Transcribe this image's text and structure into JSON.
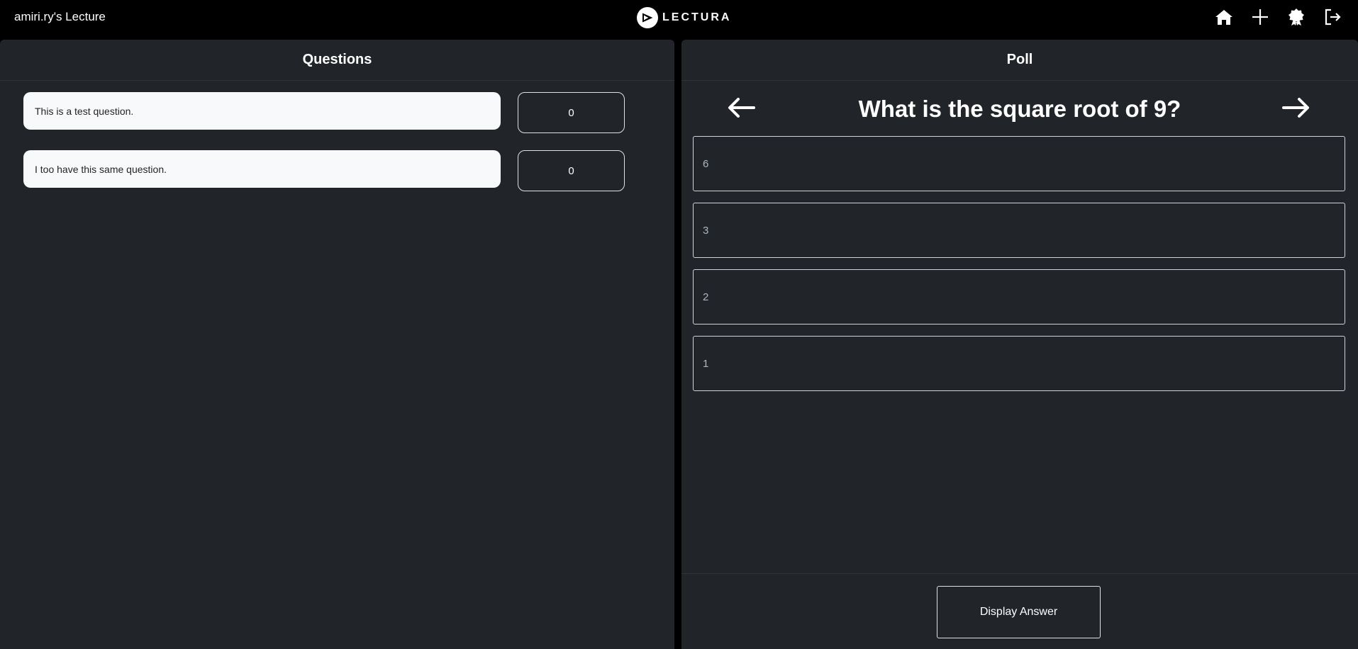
{
  "header": {
    "lecture_title": "amiri.ry's Lecture",
    "logo_text": "LECTURA",
    "nav_icons": [
      "home-icon",
      "plus-icon",
      "award-icon",
      "logout-icon"
    ]
  },
  "questions_panel": {
    "title": "Questions",
    "items": [
      {
        "text": "This is a test question.",
        "votes": "0"
      },
      {
        "text": "I too have this same question.",
        "votes": "0"
      }
    ]
  },
  "poll_panel": {
    "title": "Poll",
    "question": "What is the square root of 9?",
    "options": [
      "6",
      "3",
      "2",
      "1"
    ],
    "display_answer_label": "Display Answer"
  },
  "colors": {
    "background": "#000000",
    "panel": "#212529",
    "question_card": "#f8f9fa",
    "border": "#dee2e6"
  }
}
